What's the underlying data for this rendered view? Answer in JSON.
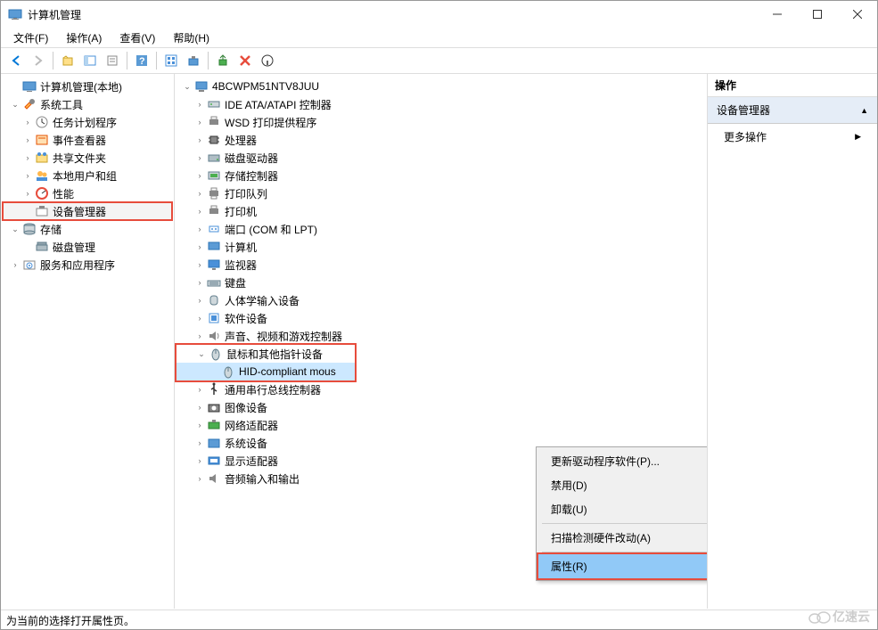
{
  "window": {
    "title": "计算机管理"
  },
  "menubar": {
    "file": "文件(F)",
    "action": "操作(A)",
    "view": "查看(V)",
    "help": "帮助(H)"
  },
  "left_tree": {
    "root": "计算机管理(本地)",
    "system_tools": "系统工具",
    "task_scheduler": "任务计划程序",
    "event_viewer": "事件查看器",
    "shared_folders": "共享文件夹",
    "local_users": "本地用户和组",
    "performance": "性能",
    "device_manager": "设备管理器",
    "storage": "存储",
    "disk_mgmt": "磁盘管理",
    "services": "服务和应用程序"
  },
  "mid_tree": {
    "root": "4BCWPM51NTV8JUU",
    "ide": "IDE ATA/ATAPI 控制器",
    "wsd": "WSD 打印提供程序",
    "cpu": "处理器",
    "disk": "磁盘驱动器",
    "storage_ctrl": "存储控制器",
    "print_queue": "打印队列",
    "printer": "打印机",
    "port": "端口 (COM 和 LPT)",
    "computer": "计算机",
    "monitor": "监视器",
    "keyboard": "键盘",
    "hid": "人体学输入设备",
    "software": "软件设备",
    "sound": "声音、视频和游戏控制器",
    "mouse_cat": "鼠标和其他指针设备",
    "hid_mouse": "HID-compliant mous",
    "usb": "通用串行总线控制器",
    "imaging": "图像设备",
    "network": "网络适配器",
    "system": "系统设备",
    "display": "显示适配器",
    "audio_io": "音频输入和输出"
  },
  "contextmenu": {
    "update": "更新驱动程序软件(P)...",
    "disable": "禁用(D)",
    "uninstall": "卸载(U)",
    "scan": "扫描检测硬件改动(A)",
    "properties": "属性(R)"
  },
  "right": {
    "header": "操作",
    "section": "设备管理器",
    "more": "更多操作"
  },
  "statusbar": {
    "text": "为当前的选择打开属性页。"
  },
  "watermark": {
    "text": "亿速云"
  }
}
